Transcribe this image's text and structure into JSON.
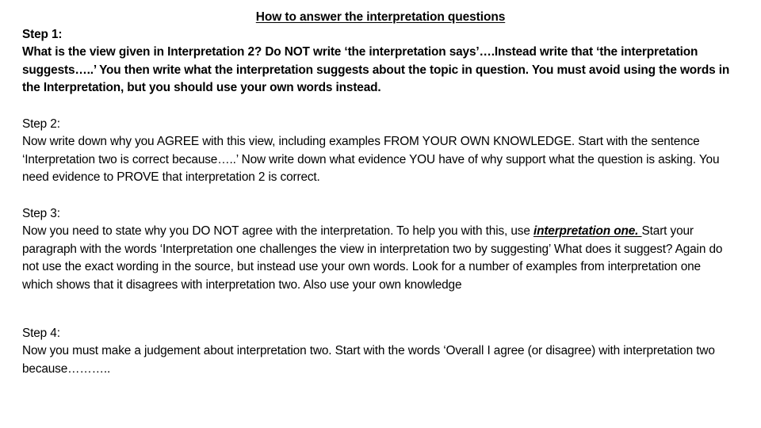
{
  "slide": {
    "title": "How to answer the interpretation questions",
    "background_color": "#ffffff",
    "text_color": "#000000",
    "steps": [
      {
        "label": "Step 1:",
        "body": "What is the view given in Interpretation 2?  Do NOT write ‘the interpretation says’….Instead write that ‘the interpretation suggests…..’  You then write what the interpretation suggests about the  topic in question.  You must avoid using the words in the Interpretation, but you should use your own words instead."
      },
      {
        "label": "Step 2:",
        "body": "Now write down why you AGREE with this view, including examples FROM YOUR OWN KNOWLEDGE.  Start with the sentence ‘Interpretation two is correct because…..’  Now write down what evidence YOU have of why support what the question is asking.  You need evidence to  PROVE that interpretation 2 is correct."
      },
      {
        "label": "Step 3:",
        "body_part1": "Now you need to state why you DO NOT agree with the interpretation.  To help you with this, use ",
        "emphasis": "interpretation one. ",
        "body_part2": " Start your paragraph with the words ‘Interpretation one challenges the view in interpretation two by suggesting’  What does it suggest?  Again do not use the exact wording in the source, but instead  use your own words.  Look for a number of examples from interpretation one which shows that it disagrees with interpretation two.  Also use your own knowledge"
      },
      {
        "label": "Step 4:",
        "body": "Now you must make a judgement about interpretation two.  Start with the words ‘Overall I agree (or disagree) with interpretation two because……….."
      }
    ]
  }
}
